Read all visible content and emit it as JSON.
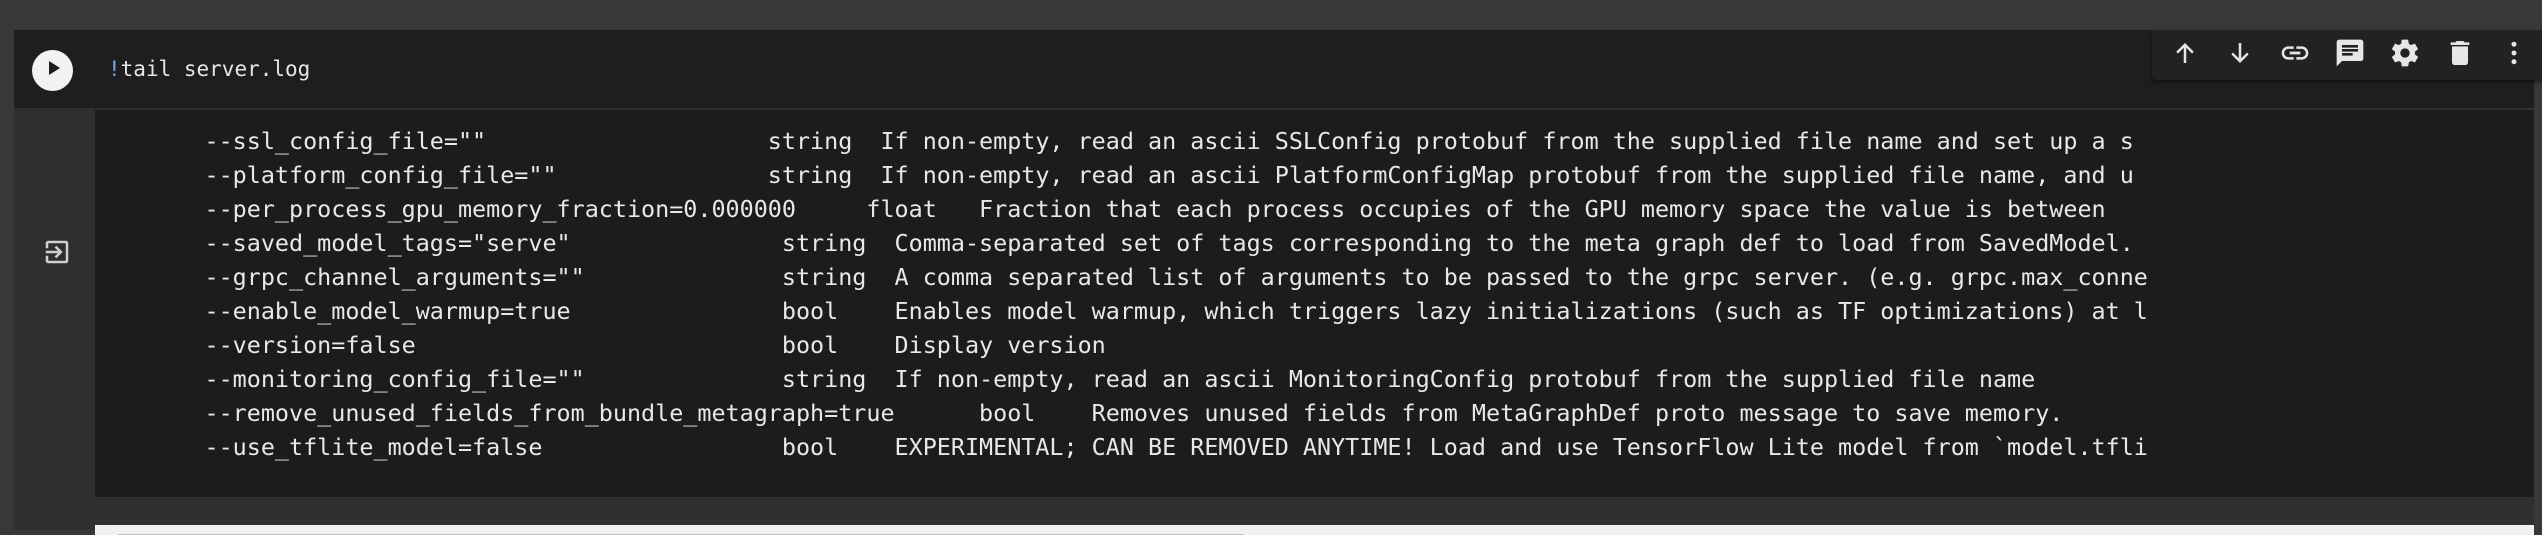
{
  "cell": {
    "command_prefix": "!",
    "command": "tail server.log",
    "run_button": "run-cell",
    "toolbar": {
      "buttons": [
        {
          "name": "move-cell-up",
          "icon": "arrow-up-icon"
        },
        {
          "name": "move-cell-down",
          "icon": "arrow-down-icon"
        },
        {
          "name": "link-to-cell",
          "icon": "link-icon"
        },
        {
          "name": "add-comment",
          "icon": "comment-icon"
        },
        {
          "name": "cell-settings",
          "icon": "gear-icon"
        },
        {
          "name": "delete-cell",
          "icon": "trash-icon"
        },
        {
          "name": "more-actions",
          "icon": "more-vertical-icon"
        }
      ]
    }
  },
  "output": {
    "icon": "output-exit-icon",
    "lines": [
      "      --ssl_config_file=\"\"                    string  If non-empty, read an ascii SSLConfig protobuf from the supplied file name and set up a s",
      "      --platform_config_file=\"\"               string  If non-empty, read an ascii PlatformConfigMap protobuf from the supplied file name, and u",
      "      --per_process_gpu_memory_fraction=0.000000     float   Fraction that each process occupies of the GPU memory space the value is between",
      "      --saved_model_tags=\"serve\"               string  Comma-separated set of tags corresponding to the meta graph def to load from SavedModel.",
      "      --grpc_channel_arguments=\"\"              string  A comma separated list of arguments to be passed to the grpc server. (e.g. grpc.max_conne",
      "      --enable_model_warmup=true               bool    Enables model warmup, which triggers lazy initializations (such as TF optimizations) at l",
      "      --version=false                          bool    Display version",
      "      --monitoring_config_file=\"\"              string  If non-empty, read an ascii MonitoringConfig protobuf from the supplied file name",
      "      --remove_unused_fields_from_bundle_metagraph=true      bool    Removes unused fields from MetaGraphDef proto message to save memory.",
      "      --use_tflite_model=false                 bool    EXPERIMENTAL; CAN BE REMOVED ANYTIME! Load and use TensorFlow Lite model from `model.tfli"
    ]
  },
  "scrollbar": {
    "horizontal_position": 0,
    "visible_fraction": 0.47
  },
  "colors": {
    "background": "#383838",
    "code_background": "#1e1e1e",
    "output_background": "#1c1c1c",
    "text": "#e8e8e8",
    "bang": "#7aa7e6",
    "toolbar": "#222222"
  }
}
